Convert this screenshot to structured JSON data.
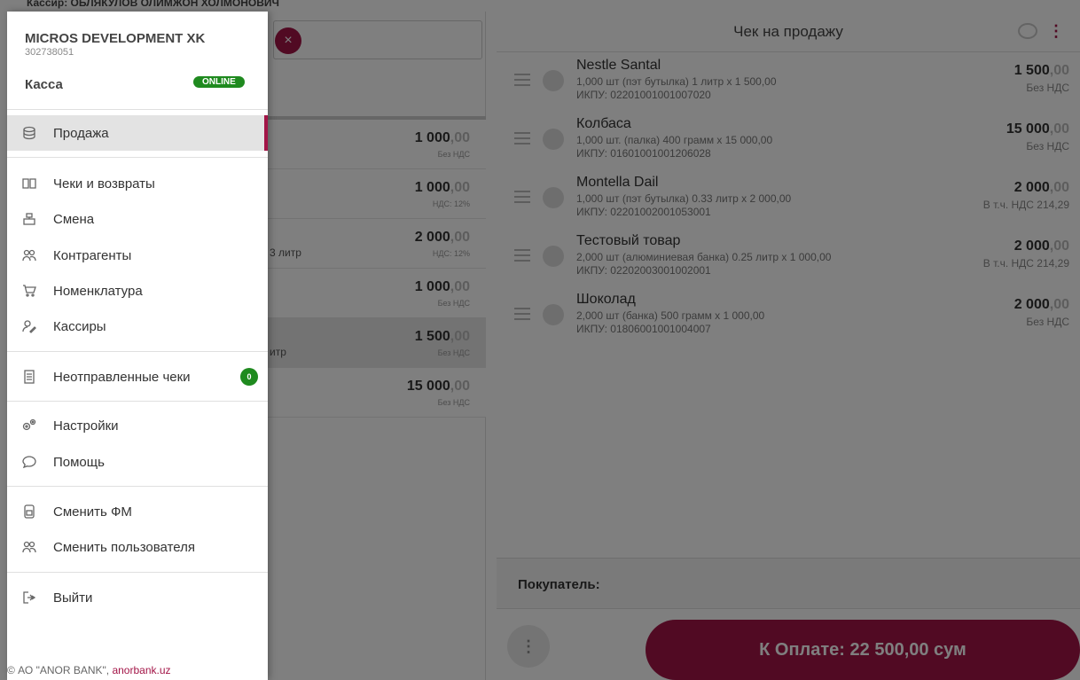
{
  "app": {
    "top_cutoff_text": "Кассир: ОБЛЯКУЛОВ ОЛИМЖОН ХОЛМОНОВИЧ"
  },
  "products": [
    {
      "name": "",
      "price_int": "1 000",
      "price_dec": ",00",
      "vat": "Без НДС"
    },
    {
      "name": "",
      "price_int": "1 000",
      "price_dec": ",00",
      "vat": "НДС: 12%"
    },
    {
      "name": "3 литр",
      "price_int": "2 000",
      "price_dec": ",00",
      "vat": "НДС: 12%"
    },
    {
      "name": "",
      "price_int": "1 000",
      "price_dec": ",00",
      "vat": "Без НДС"
    },
    {
      "name": "итр",
      "price_int": "1 500",
      "price_dec": ",00",
      "vat": "Без НДС"
    },
    {
      "name": "",
      "price_int": "15 000",
      "price_dec": ",00",
      "vat": "Без НДС"
    }
  ],
  "receipt": {
    "title": "Чек на продажу",
    "items": [
      {
        "name": "Nestle Santal",
        "desc": "1,000 шт (пэт бутылка) 1 литр x 1 500,00",
        "code": "ИКПУ: 02201001001007020",
        "total_int": "1 500",
        "total_dec": ",00",
        "vat": "Без НДС"
      },
      {
        "name": "Колбаса",
        "desc": "1,000 шт. (палка) 400 грамм x 15 000,00",
        "code": "ИКПУ: 01601001001206028",
        "total_int": "15 000",
        "total_dec": ",00",
        "vat": "Без НДС"
      },
      {
        "name": "Montella Dail",
        "desc": "1,000 шт (пэт бутылка) 0.33 литр x 2 000,00",
        "code": "ИКПУ: 02201002001053001",
        "total_int": "2 000",
        "total_dec": ",00",
        "vat": "В т.ч. НДС 214,29"
      },
      {
        "name": "Тестовый товар",
        "desc": "2,000 шт (алюминиевая банка) 0.25 литр x 1 000,00",
        "code": "ИКПУ: 02202003001002001",
        "total_int": "2 000",
        "total_dec": ",00",
        "vat": "В т.ч. НДС 214,29"
      },
      {
        "name": "Шоколад",
        "desc": "2,000 шт (банка) 500 грамм x 1 000,00",
        "code": "ИКПУ: 01806001001004007",
        "total_int": "2 000",
        "total_dec": ",00",
        "vat": "Без НДС"
      }
    ],
    "buyer_label": "Покупатель:",
    "more_label": "⋮",
    "pay_label": "К Оплате: 22 500,00 сум"
  },
  "drawer": {
    "company": "MICROS DEVELOPMENT XK",
    "tin": "302738051",
    "kassa_label": "Касса",
    "status": "ONLINE",
    "menu": [
      {
        "label": "Продажа",
        "icon": "coins-icon"
      },
      {
        "label": "Чеки и возвраты",
        "icon": "book-icon"
      },
      {
        "label": "Смена",
        "icon": "register-icon"
      },
      {
        "label": "Контрагенты",
        "icon": "users-icon"
      },
      {
        "label": "Номенклатура",
        "icon": "cart-icon"
      },
      {
        "label": "Кассиры",
        "icon": "user-edit-icon"
      },
      {
        "label": "Неотправленные чеки",
        "icon": "receipt-icon",
        "badge": "0"
      },
      {
        "label": "Настройки",
        "icon": "gears-icon"
      },
      {
        "label": "Помощь",
        "icon": "chat-icon"
      },
      {
        "label": "Сменить ФМ",
        "icon": "fiscal-module-icon"
      },
      {
        "label": "Сменить пользователя",
        "icon": "switch-user-icon"
      },
      {
        "label": "Выйти",
        "icon": "logout-icon"
      }
    ],
    "footer_text": "© АО \"ANOR BANK\", ",
    "footer_link": "anorbank.uz"
  },
  "colors": {
    "accent": "#a31547",
    "online": "#1f8a1f",
    "overlay": "rgba(0,0,0,0.5)"
  }
}
